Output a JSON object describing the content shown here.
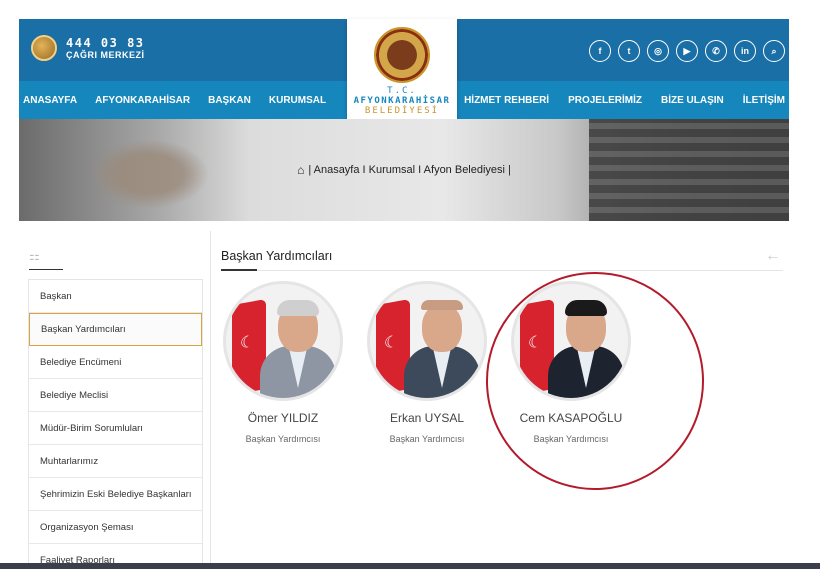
{
  "header": {
    "phone_number": "444 03 83",
    "phone_label": "ÇAĞRI MERKEZİ",
    "logo": {
      "line1": "T.C.",
      "line2": "AFYONKARAHİSAR",
      "line3": "BELEDİYESİ"
    },
    "nav_left": [
      "ANASAYFA",
      "AFYONKARAHİSAR",
      "BAŞKAN",
      "KURUMSAL"
    ],
    "nav_right": [
      "HİZMET REHBERİ",
      "PROJELERİMİZ",
      "BİZE ULAŞIN",
      "İLETİŞİM"
    ],
    "social": [
      {
        "icon": "facebook-icon",
        "glyph": "f"
      },
      {
        "icon": "twitter-icon",
        "glyph": "t"
      },
      {
        "icon": "instagram-icon",
        "glyph": "◎"
      },
      {
        "icon": "youtube-icon",
        "glyph": "▶"
      },
      {
        "icon": "whatsapp-icon",
        "glyph": "✆"
      },
      {
        "icon": "linkedin-icon",
        "glyph": "in"
      },
      {
        "icon": "search-icon",
        "glyph": "⌕"
      }
    ]
  },
  "breadcrumb": {
    "home_glyph": "⌂",
    "text": "| Anasayfa I Kurumsal I Afyon Belediyesi |"
  },
  "sidebar": {
    "icon_glyph": "⚏",
    "items": [
      "Başkan",
      "Başkan Yardımcıları",
      "Belediye Encümeni",
      "Belediye Meclisi",
      "Müdür-Birim Sorumluları",
      "Muhtarlarımız",
      "Şehrimizin Eski Belediye Başkanları",
      "Organizasyon Şeması",
      "Faaliyet Raporları"
    ],
    "active_index": 1
  },
  "main": {
    "title": "Başkan Yardımcıları",
    "back_glyph": "←",
    "people": [
      {
        "name": "Ömer YILDIZ",
        "role": "Başkan Yardımcısı"
      },
      {
        "name": "Erkan UYSAL",
        "role": "Başkan Yardımcısı"
      },
      {
        "name": "Cem KASAPOĞLU",
        "role": "Başkan Yardımcısı"
      }
    ]
  },
  "colors": {
    "header_dark": "#1a6fa6",
    "header_band": "#1687bd",
    "accent_gold": "#d9a441",
    "annotation_red": "#b31b2b"
  }
}
